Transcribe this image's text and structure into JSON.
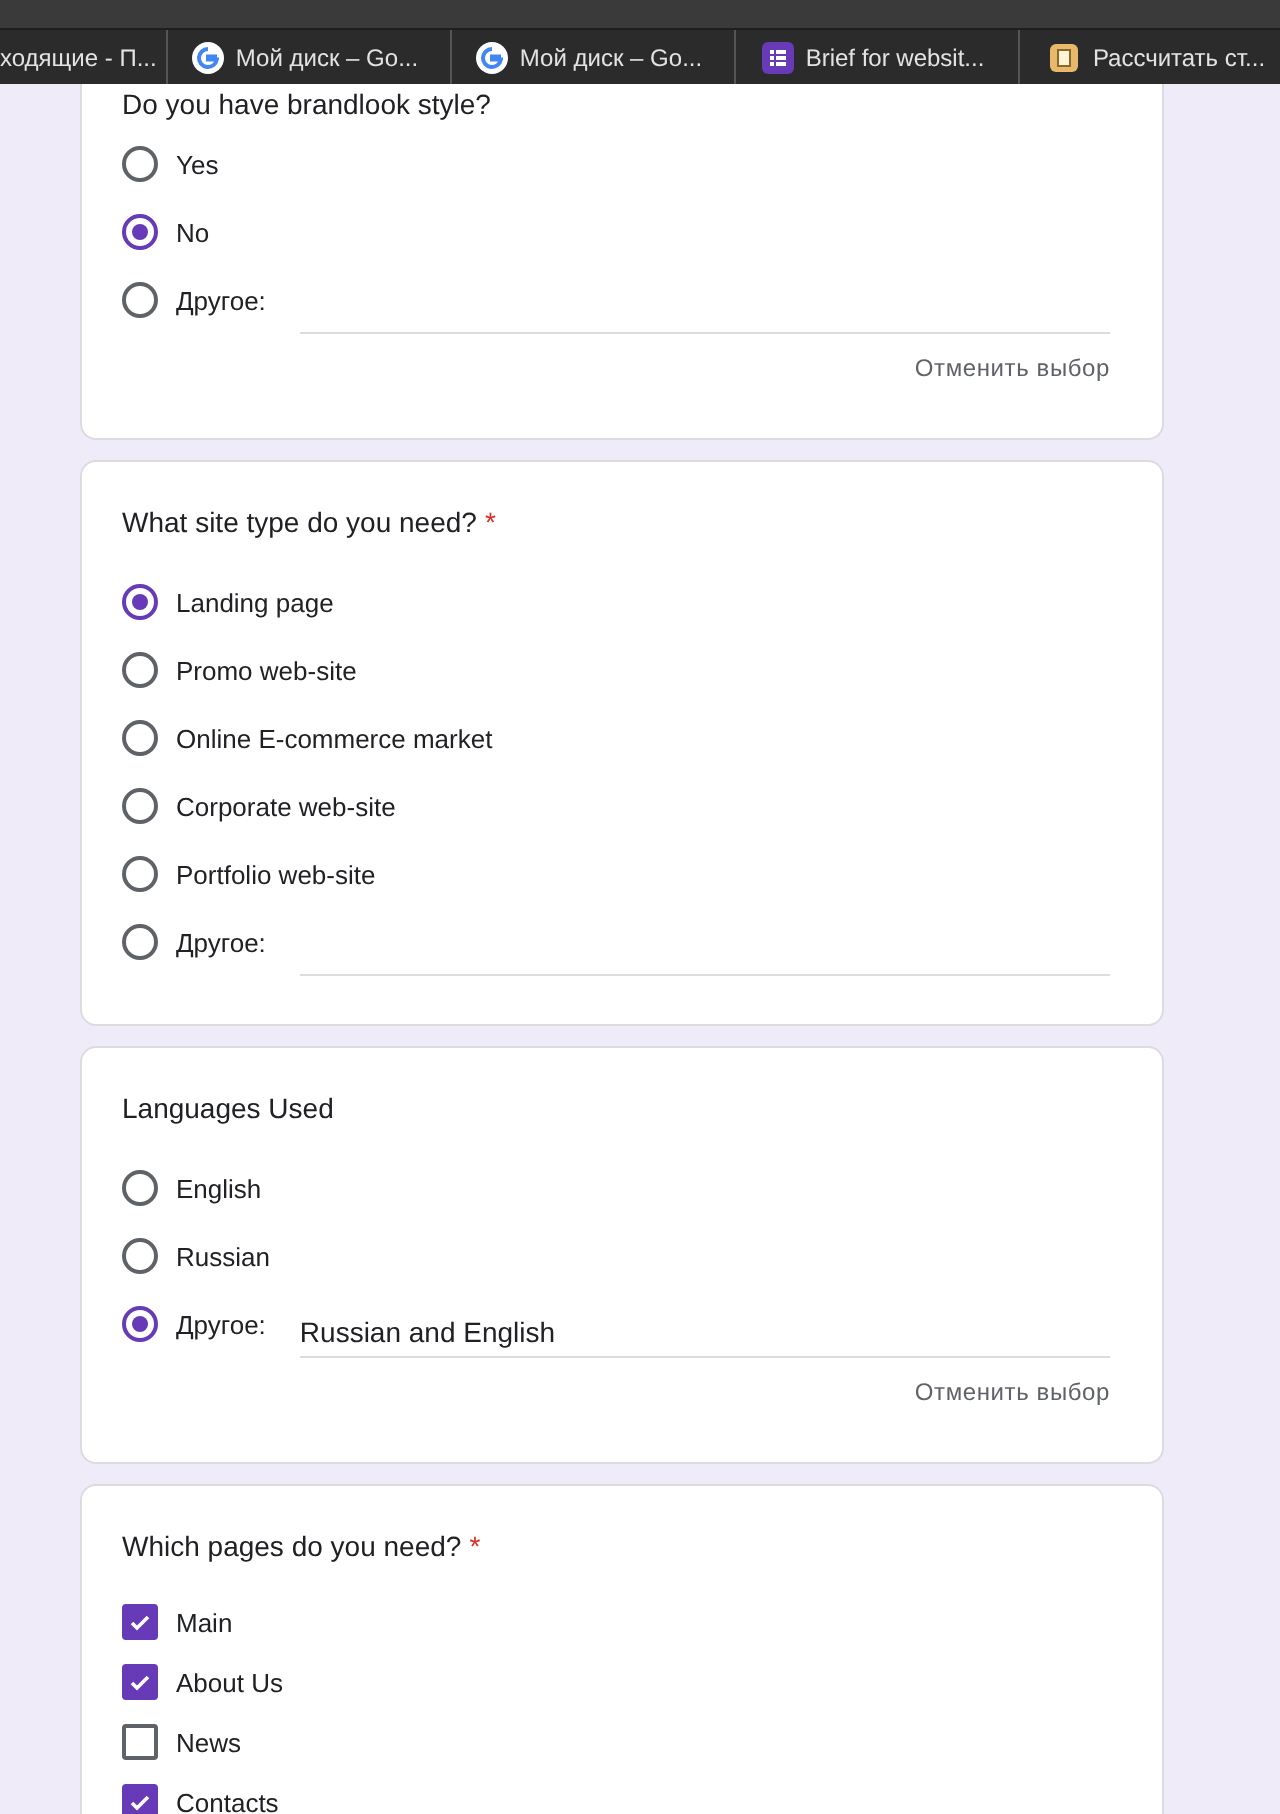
{
  "browser_tabs": [
    {
      "title": "ходящие - П...",
      "kind": "plain",
      "selected": false
    },
    {
      "title": "Мой диск – Go...",
      "kind": "google",
      "selected": false
    },
    {
      "title": "Мой диск – Go...",
      "kind": "google",
      "selected": false
    },
    {
      "title": "Brief for websit...",
      "kind": "form",
      "selected": false
    },
    {
      "title": "Рассчитать ст...",
      "kind": "box",
      "selected": false
    }
  ],
  "questions": [
    {
      "kind": "radio",
      "title": "Do you have brandlook style?",
      "clear": "Отменить выбор",
      "options": [
        {
          "kind": "plain",
          "label": "Yes",
          "selected": false
        },
        {
          "kind": "plain",
          "label": "No",
          "selected": true
        },
        {
          "kind": "other",
          "label": "Другое:",
          "selected": false
        }
      ]
    },
    {
      "kind": "radio",
      "title": "What site type do you need?",
      "required_mark": "*",
      "options": [
        {
          "kind": "plain",
          "label": "Landing page",
          "selected": true
        },
        {
          "kind": "plain",
          "label": "Promo web-site",
          "selected": false
        },
        {
          "kind": "plain",
          "label": "Online E-commerce market",
          "selected": false
        },
        {
          "kind": "plain",
          "label": "Corporate web-site",
          "selected": false
        },
        {
          "kind": "plain",
          "label": "Portfolio web-site",
          "selected": false
        },
        {
          "kind": "other",
          "label": "Другое:",
          "selected": false
        }
      ]
    },
    {
      "kind": "radio",
      "title": "Languages Used",
      "clear": "Отменить выбор",
      "options": [
        {
          "kind": "plain",
          "label": "English",
          "selected": false
        },
        {
          "kind": "plain",
          "label": "Russian",
          "selected": false
        },
        {
          "kind": "other",
          "label": "Другое:",
          "value": "Russian and English",
          "selected": true
        }
      ]
    },
    {
      "kind": "checkbox",
      "title": "Which pages do you need?",
      "required_mark": "*",
      "options": [
        {
          "kind": "plain",
          "label": "Main",
          "checked": true
        },
        {
          "kind": "plain",
          "label": "About Us",
          "checked": true
        },
        {
          "kind": "plain",
          "label": "News",
          "checked": false
        },
        {
          "kind": "plain",
          "label": "Contacts",
          "checked": true
        }
      ]
    }
  ]
}
